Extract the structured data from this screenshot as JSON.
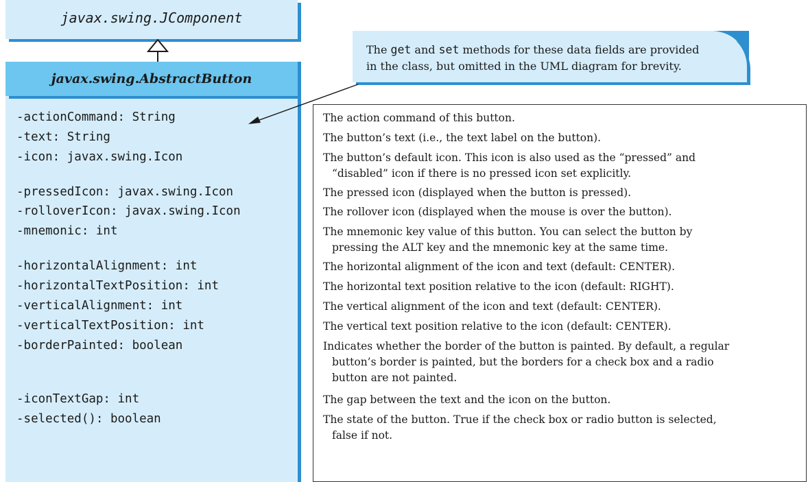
{
  "superclass": {
    "name": "javax.swing.JComponent"
  },
  "class": {
    "name": "javax.swing.AbstractButton",
    "attributes": [
      "-actionCommand: String",
      "-text: String",
      "-icon: javax.swing.Icon",
      "-pressedIcon: javax.swing.Icon",
      "-rolloverIcon: javax.swing.Icon",
      "-mnemonic: int",
      "-horizontalAlignment: int",
      "-horizontalTextPosition: int",
      "-verticalAlignment: int",
      "-verticalTextPosition: int",
      "-borderPainted: boolean",
      "-iconTextGap: int",
      "-selected(): boolean"
    ]
  },
  "note": {
    "t1": "The ",
    "get": "get",
    "t2": " and ",
    "set": "set",
    "t3": " methods for these data fields are provided",
    "line2": "in the class, but omitted in the UML diagram for brevity."
  },
  "descriptions": [
    {
      "lines": [
        "The action command of this button."
      ]
    },
    {
      "lines": [
        "The button’s text (i.e., the text label on the button)."
      ]
    },
    {
      "lines": [
        "The button’s default icon. This icon is also used as the “pressed” and",
        "“disabled” icon if there is no pressed icon set explicitly."
      ]
    },
    {
      "lines": [
        "The pressed icon (displayed when the button is pressed)."
      ]
    },
    {
      "lines": [
        "The rollover icon (displayed when the mouse is over the button)."
      ]
    },
    {
      "lines": [
        "The mnemonic key value of this button. You can select the button by",
        "pressing the ALT key and the mnemonic key at the same time."
      ]
    },
    {
      "lines": [
        "The horizontal alignment of the icon and text (default: CENTER)."
      ]
    },
    {
      "lines": [
        "The horizontal text position relative to the icon (default: RIGHT)."
      ]
    },
    {
      "lines": [
        "The vertical alignment of the icon and text (default: CENTER)."
      ]
    },
    {
      "lines": [
        "The vertical text position relative to the icon (default: CENTER)."
      ]
    },
    {
      "lines": [
        "Indicates whether the border of the button is painted. By default, a regular",
        "button’s border is painted, but the borders for a check box and a radio",
        "button are not painted."
      ]
    },
    {
      "lines": [
        "The gap between the text and the icon on the button."
      ]
    },
    {
      "lines": [
        "The state of the button. True if the check box or radio button is selected,",
        "false if not."
      ]
    }
  ],
  "colors": {
    "box_fill": "#d5edfa",
    "header_fill": "#6cc6f0",
    "shadow": "#2d8fd0"
  }
}
